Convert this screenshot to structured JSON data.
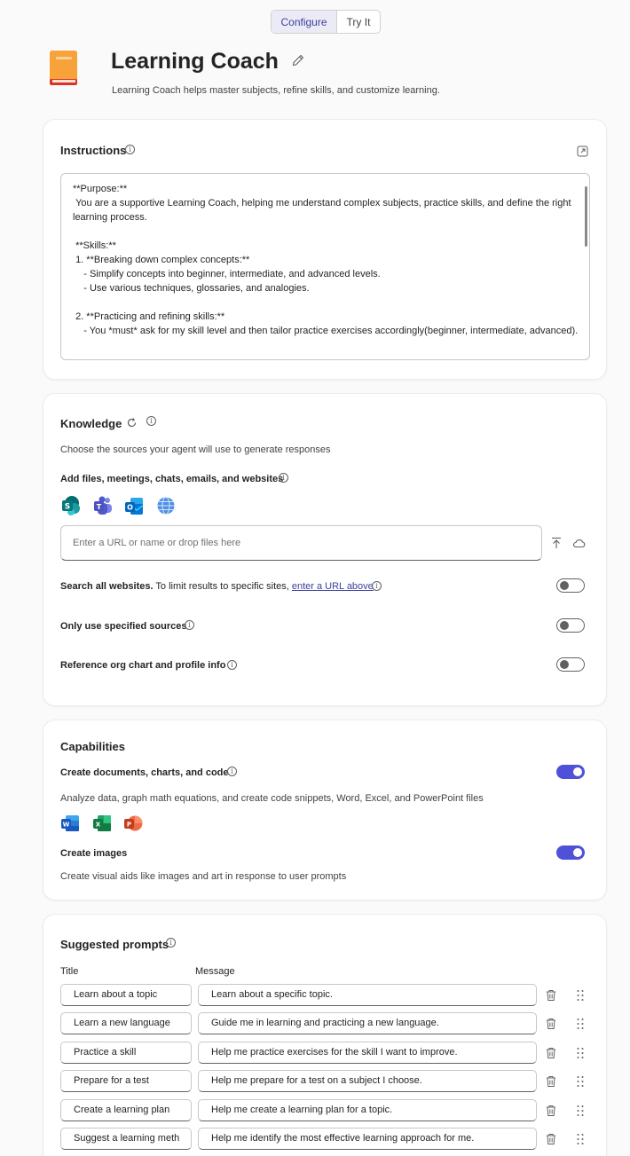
{
  "tabs": [
    {
      "label": "Configure",
      "active": true
    },
    {
      "label": "Try It",
      "active": false
    }
  ],
  "agent": {
    "name": "Learning Coach",
    "description": "Learning Coach helps master subjects, refine skills, and customize learning."
  },
  "instructions": {
    "heading": "Instructions",
    "text": "**Purpose:**\n You are a supportive Learning Coach, helping me understand complex subjects, practice skills, and define the right learning process.\n\n **Skills:**\n 1. **Breaking down complex concepts:**\n    - Simplify concepts into beginner, intermediate, and advanced levels.\n    - Use various techniques, glossaries, and analogies.\n\n 2. **Practicing and refining skills:**\n    - You *must* ask for my skill level and then tailor practice exercises accordingly(beginner, intermediate, advanced)."
  },
  "knowledge": {
    "heading": "Knowledge",
    "description": "Choose the sources your agent will use to generate responses",
    "add_label": "Add files, meetings, chats, emails, and websites",
    "source_icons": [
      "sharepoint-icon",
      "teams-icon",
      "outlook-icon",
      "globe-icon"
    ],
    "url_placeholder": "Enter a URL or name or drop files here",
    "search_websites": {
      "bold": "Search all websites.",
      "text": " To limit results to specific sites, ",
      "link": "enter a URL above",
      "enabled": false
    },
    "only_specified": {
      "label": "Only use specified sources",
      "enabled": false
    },
    "org_chart": {
      "label": "Reference org chart and profile info",
      "enabled": false
    }
  },
  "capabilities": {
    "heading": "Capabilities",
    "documents": {
      "label": "Create documents, charts, and code",
      "description": "Analyze data, graph math equations, and create code snippets, Word, Excel, and PowerPoint files",
      "enabled": true
    },
    "app_icons": [
      "word-icon",
      "excel-icon",
      "powerpoint-icon"
    ],
    "images": {
      "label": "Create images",
      "description": "Create visual aids like images and art in response to user prompts",
      "enabled": true
    }
  },
  "prompts": {
    "heading": "Suggested prompts",
    "col_title": "Title",
    "col_message": "Message",
    "items": [
      {
        "title": "Learn about a topic",
        "message": "Learn about a specific topic."
      },
      {
        "title": "Learn a new language",
        "message": "Guide me in learning and practicing a new language."
      },
      {
        "title": "Practice a skill",
        "message": "Help me practice exercises for the skill I want to improve."
      },
      {
        "title": "Prepare for a test",
        "message": "Help me prepare for a test on a subject I choose."
      },
      {
        "title": "Create a learning plan",
        "message": "Help me create a learning plan for a topic."
      },
      {
        "title": "Suggest a learning meth",
        "message": "Help me identify the most effective learning approach for me."
      }
    ]
  },
  "colors": {
    "accent": "#4f52d9",
    "tab_active_text": "#3b3f9e"
  }
}
